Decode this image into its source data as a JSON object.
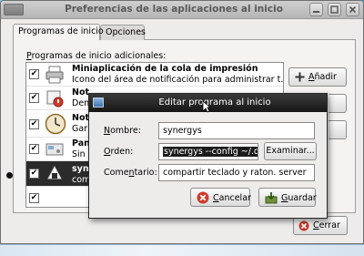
{
  "window": {
    "title": "Preferencias de las aplicaciones al inicio",
    "menu_label": "",
    "tabs": [
      {
        "label": "Programas de inicio"
      },
      {
        "label": "Opciones"
      }
    ],
    "list_heading_prefix": "P",
    "list_heading_rest": "rogramas de inicio adicionales:",
    "items": [
      {
        "title": "Miniaplicación de la cola de impresión",
        "desc": "Icono del área de notificación para administrar t...",
        "checked": true,
        "icon": "printer-icon"
      },
      {
        "title": "Not",
        "desc": "Den",
        "checked": true,
        "icon": "notification-icon"
      },
      {
        "title": "Not",
        "desc": "Gar",
        "checked": true,
        "icon": "clock-icon"
      },
      {
        "title": "Pan",
        "desc": "Sin",
        "checked": true,
        "icon": "panel-icon"
      },
      {
        "title": "syn",
        "desc": "com",
        "checked": true,
        "icon": "synergy-icon",
        "selected": true
      }
    ],
    "add_button": "Añadir",
    "add_button_prefix": "A",
    "add_button_rest": "ñadir",
    "close_button": "Cerrar",
    "close_button_prefix": "C",
    "close_button_rest": "errar"
  },
  "dialog": {
    "title": "Editar programa al inicio",
    "name_label_prefix": "N",
    "name_label_rest": "ombre:",
    "name_value": "synergys",
    "command_label_prefix": "O",
    "command_label_rest": "rden:",
    "command_value": "synergys --config ~/.qui",
    "browse_button": "Examinar...",
    "comment_label_pre": "Come",
    "comment_label_u": "n",
    "comment_label_post": "tario:",
    "comment_value": "compartir teclado y raton. server",
    "cancel_button_prefix": "C",
    "cancel_button_rest": "ancelar",
    "save_button_prefix": "G",
    "save_button_rest": "uardar"
  },
  "colors": {
    "desktop": "#2d9de0",
    "selection": "#2b2b2b",
    "dialog_titlebar": "#161616"
  }
}
